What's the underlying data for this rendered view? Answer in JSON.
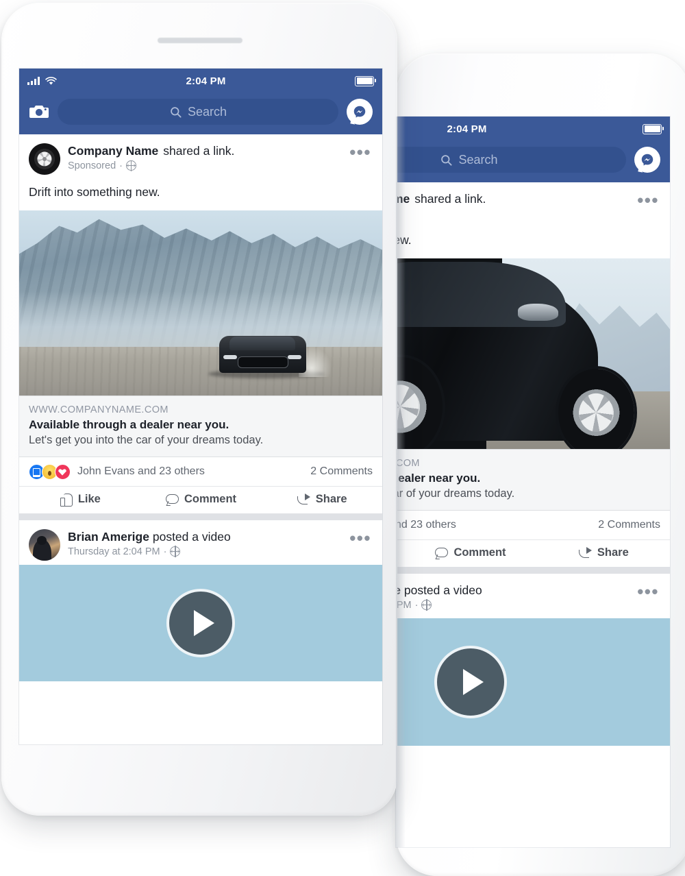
{
  "status_bar": {
    "time": "2:04 PM",
    "signal_icon": "cellular-signal-icon",
    "wifi_icon": "wifi-icon",
    "battery_icon": "battery-icon"
  },
  "nav": {
    "camera_icon": "camera-icon",
    "search_placeholder": "Search",
    "search_icon": "search-icon",
    "messenger_icon": "messenger-icon"
  },
  "post_ad": {
    "avatar_icon": "tire-avatar",
    "author": "Company Name",
    "action": "shared a link.",
    "meta": "Sponsored",
    "privacy_icon": "globe-icon",
    "menu_icon": "more-options-icon",
    "body": "Drift into something new.",
    "media_alt": "car-driving-in-desert-video",
    "link": {
      "url": "WWW.COMPANYNAME.COM",
      "title": "Available through a dealer near you.",
      "description": "Let's get you into the car of your dreams today."
    },
    "reactions": {
      "icons": [
        "like-reaction",
        "wow-reaction",
        "love-reaction"
      ],
      "names": "John Evans and 23 others",
      "comments": "2 Comments"
    },
    "actions": [
      {
        "label": "Like",
        "icon": "thumbs-up-icon"
      },
      {
        "label": "Comment",
        "icon": "comment-bubble-icon"
      },
      {
        "label": "Share",
        "icon": "share-arrow-icon"
      }
    ]
  },
  "post_video": {
    "avatar_icon": "person-photo-avatar",
    "author": "Brian Amerige",
    "action": "posted a video",
    "meta": "Thursday at 2:04 PM",
    "privacy_icon": "globe-icon",
    "menu_icon": "more-options-icon",
    "play_icon": "play-button-icon"
  },
  "colors": {
    "facebook_blue": "#3b5998",
    "search_field": "#33518e",
    "feed_background": "#e9ebee",
    "link_card_background": "#f5f6f7",
    "text_primary": "#1d2129",
    "text_secondary": "#616770",
    "text_muted": "#8d949e",
    "video_placeholder": "#a3cbdd",
    "play_button": "#4c5c66",
    "like_blue": "#1877f2",
    "love_red": "#f0365a",
    "wow_yellow": "#f5b324"
  }
}
